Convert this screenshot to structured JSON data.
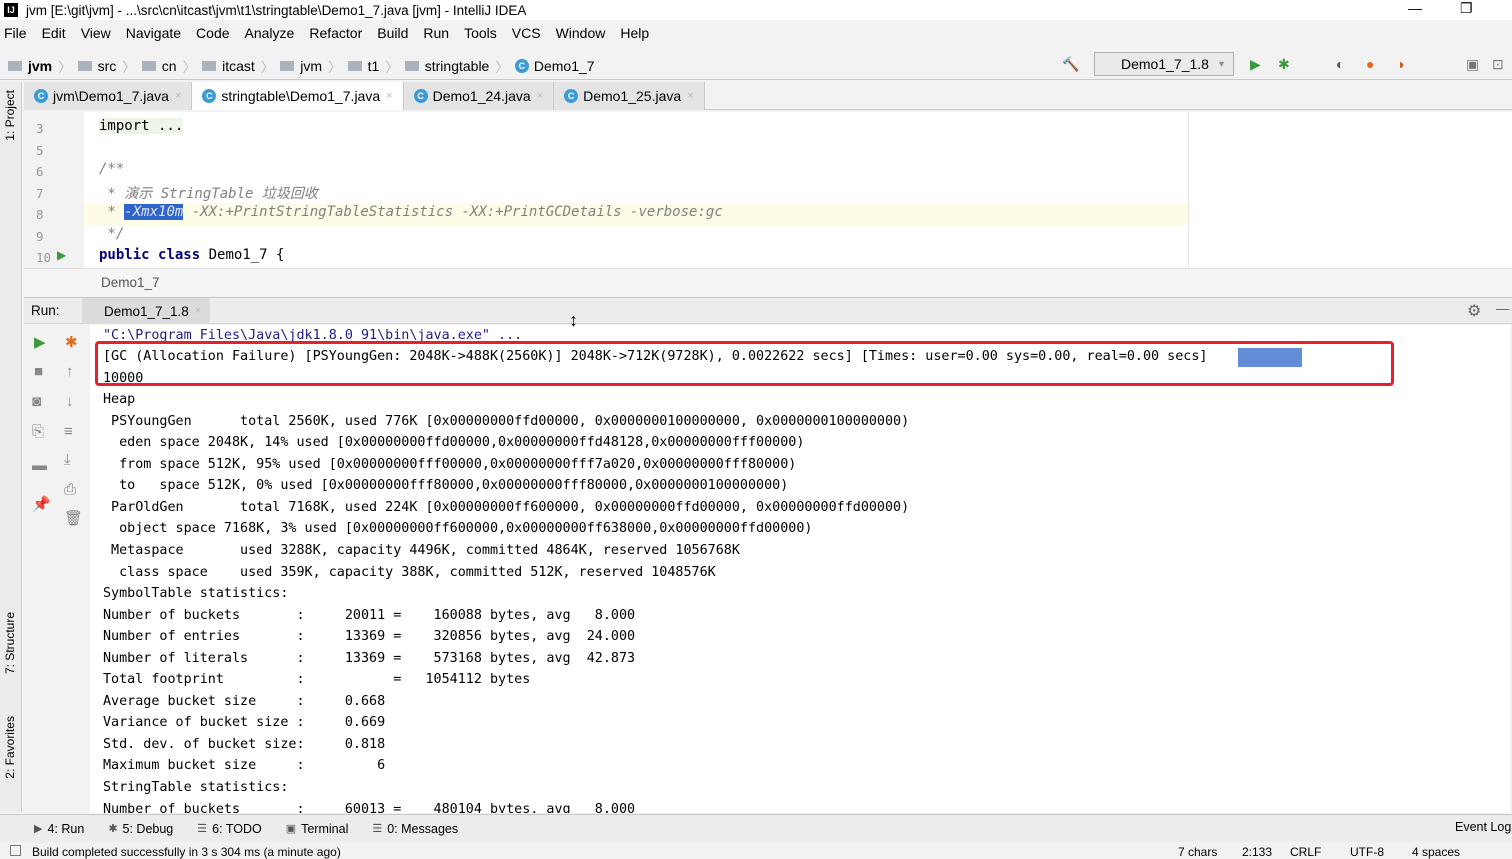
{
  "window": {
    "title": "jvm [E:\\git\\jvm] - ...\\src\\cn\\itcast\\jvm\\t1\\stringtable\\Demo1_7.java [jvm] - IntelliJ IDEA",
    "app_icon": "IJ"
  },
  "menu": [
    "File",
    "Edit",
    "View",
    "Navigate",
    "Code",
    "Analyze",
    "Refactor",
    "Build",
    "Run",
    "Tools",
    "VCS",
    "Window",
    "Help"
  ],
  "breadcrumb": [
    "jvm",
    "src",
    "cn",
    "itcast",
    "jvm",
    "t1",
    "stringtable",
    "Demo1_7"
  ],
  "toolbar": {
    "run_config": "Demo1_7_1.8"
  },
  "tabs": [
    {
      "label": "jvm\\Demo1_7.java",
      "active": false
    },
    {
      "label": "stringtable\\Demo1_7.java",
      "active": true
    },
    {
      "label": "Demo1_24.java",
      "active": false
    },
    {
      "label": "Demo1_25.java",
      "active": false
    }
  ],
  "side_labels": {
    "project": "1: Project",
    "structure": "7: Structure",
    "favorites": "2: Favorites"
  },
  "editor": {
    "lines": [
      {
        "n": "3",
        "text": "import ..."
      },
      {
        "n": "5",
        "text": ""
      },
      {
        "n": "6",
        "text": "/**"
      },
      {
        "n": "7",
        "text": " * 演示 StringTable 垃圾回收"
      },
      {
        "n": "8",
        "text": " * -Xmx10m -XX:+PrintStringTableStatistics -XX:+PrintGCDetails -verbose:gc"
      },
      {
        "n": "9",
        "text": " */"
      },
      {
        "n": "10",
        "text": "public class Demo1_7 {"
      }
    ],
    "line8_selected": "-Xmx10m",
    "line8_rest": " -XX:+PrintStringTableStatistics -XX:+PrintGCDetails -verbose:gc",
    "kw_public": "public",
    "kw_class": "class",
    "class_rest": " Demo1_7 {",
    "structure_crumb": "Demo1_7"
  },
  "run": {
    "label": "Run:",
    "tab": "Demo1_7_1.8",
    "console": [
      "\"C:\\Program Files\\Java\\jdk1.8.0_91\\bin\\java.exe\" ...",
      "[GC (Allocation Failure) [PSYoungGen: 2048K->488K(2560K)] 2048K->712K(9728K), 0.0022622 secs] [Times: user=0.00 sys=0.00, real=0.00 secs]",
      "10000",
      "Heap",
      " PSYoungGen      total 2560K, used 776K [0x00000000ffd00000, 0x0000000100000000, 0x0000000100000000)",
      "  eden space 2048K, 14% used [0x00000000ffd00000,0x00000000ffd48128,0x00000000fff00000)",
      "  from space 512K, 95% used [0x00000000fff00000,0x00000000fff7a020,0x00000000fff80000)",
      "  to   space 512K, 0% used [0x00000000fff80000,0x00000000fff80000,0x0000000100000000)",
      " ParOldGen       total 7168K, used 224K [0x00000000ff600000, 0x00000000ffd00000, 0x00000000ffd00000)",
      "  object space 7168K, 3% used [0x00000000ff600000,0x00000000ff638000,0x00000000ffd00000)",
      " Metaspace       used 3288K, capacity 4496K, committed 4864K, reserved 1056768K",
      "  class space    used 359K, capacity 388K, committed 512K, reserved 1048576K",
      "SymbolTable statistics:",
      "Number of buckets       :     20011 =    160088 bytes, avg   8.000",
      "Number of entries       :     13369 =    320856 bytes, avg  24.000",
      "Number of literals      :     13369 =    573168 bytes, avg  42.873",
      "Total footprint         :           =   1054112 bytes",
      "Average bucket size     :     0.668",
      "Variance of bucket size :     0.669",
      "Std. dev. of bucket size:     0.818",
      "Maximum bucket size     :         6",
      "StringTable statistics:",
      "Number of buckets       :     60013 =    480104 bytes, avg   8.000"
    ]
  },
  "bottom_tabs": [
    "4: Run",
    "5: Debug",
    "6: TODO",
    "Terminal",
    "0: Messages"
  ],
  "event_log": "Event Log",
  "status": {
    "message": "Build completed successfully in 3 s 304 ms (a minute ago)",
    "chars": "7 chars",
    "position": "2:133",
    "line_sep": "CRLF",
    "encoding": "UTF-8",
    "indent": "4 spaces"
  },
  "colors": {
    "highlight_box": "#e8202a",
    "selection": "#2f65ca",
    "run_green": "#3c9a3c"
  }
}
